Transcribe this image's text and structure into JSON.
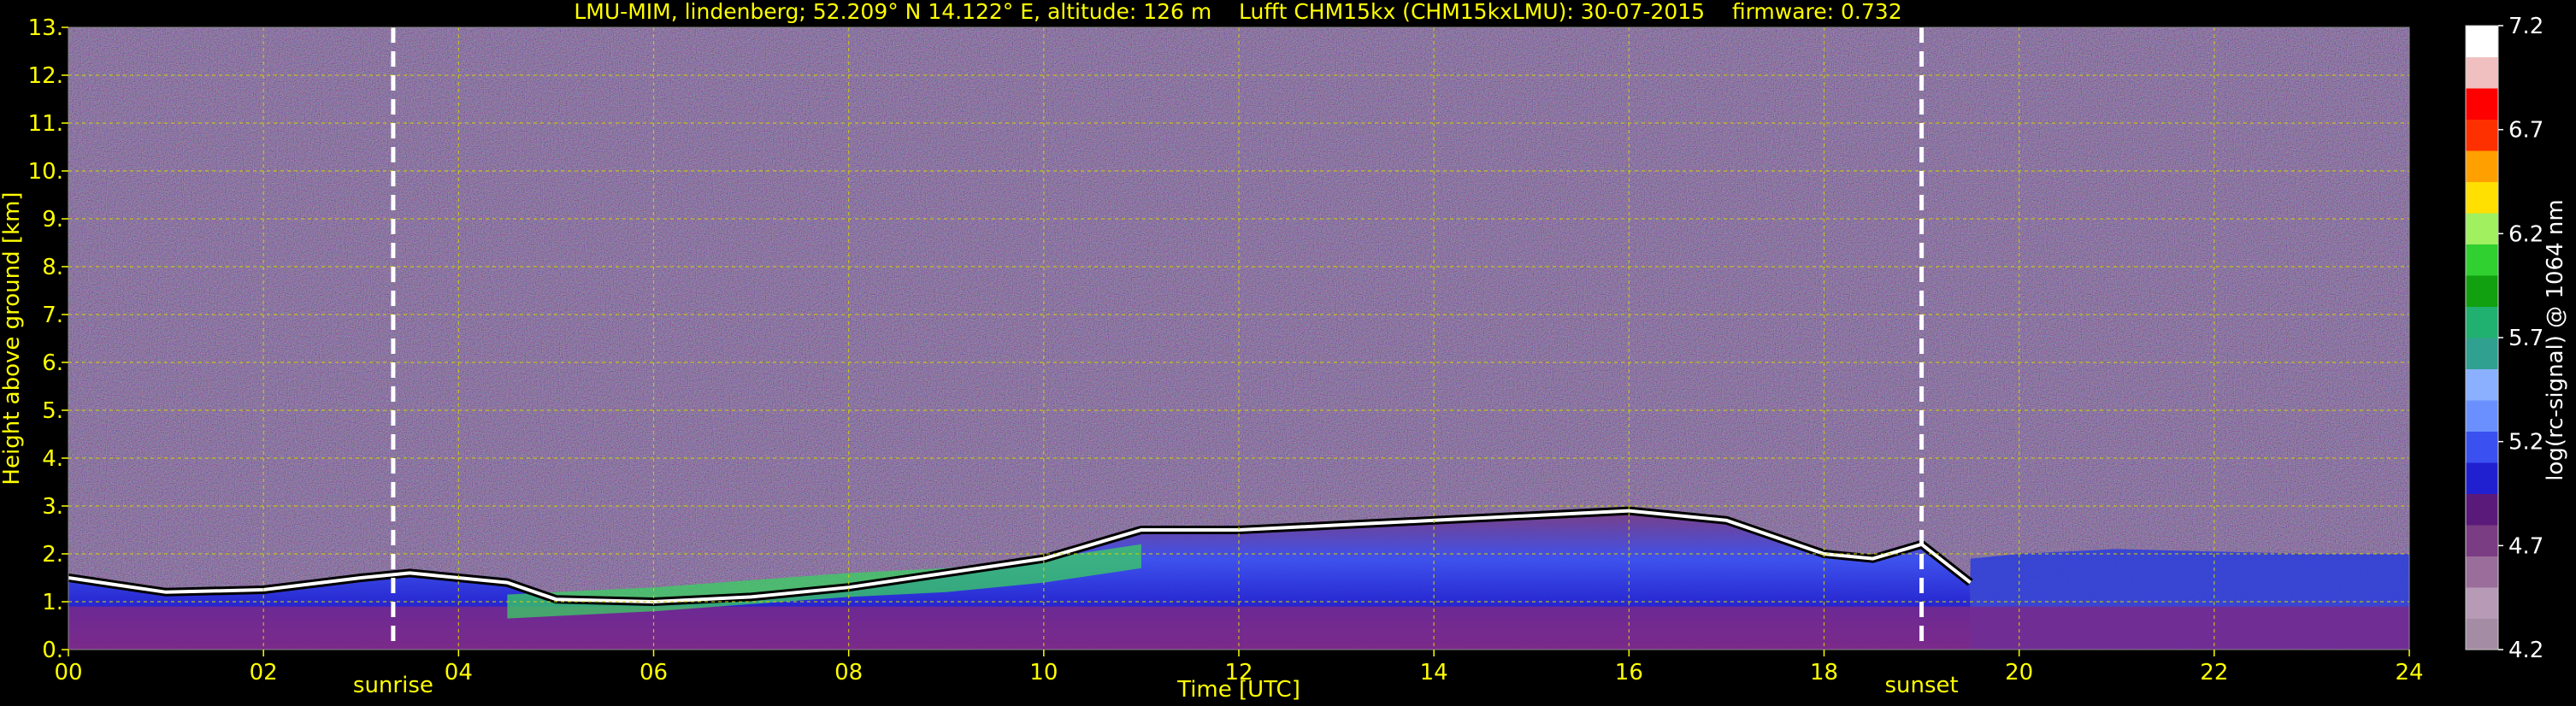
{
  "chart_data": {
    "type": "heatmap",
    "title": "LMU-MIM, lindenberg; 52.209° N 14.122° E, altitude: 126 m    Lufft CHM15kx (CHM15kxLMU): 30-07-2015    firmware: 0.732",
    "xlabel": "Time [UTC]",
    "ylabel": "Height above ground [km]",
    "xlim": [
      0,
      24
    ],
    "ylim": [
      0,
      13
    ],
    "x_ticks": [
      "00",
      "02",
      "04",
      "06",
      "08",
      "10",
      "12",
      "14",
      "16",
      "18",
      "20",
      "22",
      "24"
    ],
    "x_tick_values": [
      0,
      2,
      4,
      6,
      8,
      10,
      12,
      14,
      16,
      18,
      20,
      22,
      24
    ],
    "y_ticks": [
      "0.",
      "1.",
      "2.",
      "3.",
      "4.",
      "5.",
      "6.",
      "7.",
      "8.",
      "9.",
      "10.",
      "11.",
      "12.",
      "13."
    ],
    "y_tick_values": [
      0,
      1,
      2,
      3,
      4,
      5,
      6,
      7,
      8,
      9,
      10,
      11,
      12,
      13
    ],
    "grid": true,
    "annotations": [
      {
        "label": "sunrise",
        "x": 3.33
      },
      {
        "label": "sunset",
        "x": 19.0
      }
    ],
    "colorbar": {
      "label": "log(rc-signal) @ 1064 nm",
      "ticks": [
        "4.2",
        "4.7",
        "5.2",
        "5.7",
        "6.2",
        "6.7",
        "7.2"
      ],
      "tick_values": [
        4.2,
        4.7,
        5.2,
        5.7,
        6.2,
        6.7,
        7.2
      ],
      "range": [
        4.2,
        7.2
      ],
      "colors": [
        "#a58ca5",
        "#b69ab6",
        "#9a6d9a",
        "#7a3c82",
        "#5a1a7a",
        "#2020d0",
        "#3a50f0",
        "#6a90ff",
        "#8ab0ff",
        "#30a090",
        "#20b070",
        "#10a010",
        "#30d030",
        "#a0f060",
        "#ffe000",
        "#ffa000",
        "#ff3000",
        "#ff0000",
        "#f0c0c0",
        "#ffffff"
      ]
    },
    "boundary_layer_top_km": [
      [
        0,
        1.5
      ],
      [
        1,
        1.2
      ],
      [
        2,
        1.25
      ],
      [
        3,
        1.5
      ],
      [
        3.5,
        1.6
      ],
      [
        4.5,
        1.4
      ],
      [
        5,
        1.05
      ],
      [
        6,
        1.0
      ],
      [
        7,
        1.1
      ],
      [
        8,
        1.3
      ],
      [
        9,
        1.6
      ],
      [
        10,
        1.9
      ],
      [
        11,
        2.5
      ],
      [
        12,
        2.5
      ],
      [
        13,
        2.6
      ],
      [
        14,
        2.7
      ],
      [
        15,
        2.8
      ],
      [
        16,
        2.9
      ],
      [
        17,
        2.7
      ],
      [
        18,
        2.0
      ],
      [
        18.5,
        1.9
      ],
      [
        19,
        2.2
      ],
      [
        19.5,
        1.4
      ]
    ],
    "colors": {
      "text": "#ffff00",
      "grid": "#d0d000",
      "marker": "#ffffff",
      "background": "#000000"
    }
  }
}
